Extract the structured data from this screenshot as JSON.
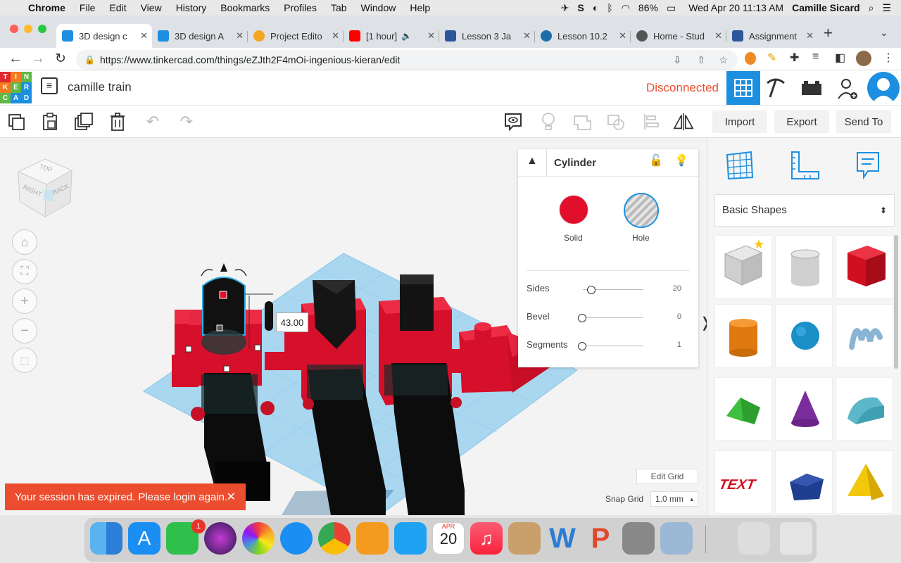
{
  "menubar": {
    "app": "Chrome",
    "items": [
      "File",
      "Edit",
      "View",
      "History",
      "Bookmarks",
      "Profiles",
      "Tab",
      "Window",
      "Help"
    ],
    "battery": "86%",
    "datetime": "Wed Apr 20  11:13 AM",
    "user": "Camille Sicard"
  },
  "tabs": [
    {
      "label": "3D design c",
      "active": true
    },
    {
      "label": "3D design A"
    },
    {
      "label": "Project Edito"
    },
    {
      "label": "[1 hour]"
    },
    {
      "label": "Lesson 3 Ja"
    },
    {
      "label": "Lesson 10.2"
    },
    {
      "label": "Home - Stud"
    },
    {
      "label": "Assignment"
    }
  ],
  "url": "https://www.tinkercad.com/things/eZJth2F4mOi-ingenious-kieran/edit",
  "logo": {
    "letters": [
      "T",
      "I",
      "N",
      "K",
      "E",
      "R",
      "C",
      "A",
      "D"
    ]
  },
  "project": {
    "name": "camille train",
    "status": "Disconnected"
  },
  "toolbar": {
    "import": "Import",
    "export": "Export",
    "send_to": "Send To"
  },
  "viewcube": {
    "top": "TOP",
    "right": "RIGHT",
    "back": "BACK"
  },
  "measure": {
    "value": "43.00"
  },
  "inspector": {
    "title": "Cylinder",
    "solid": "Solid",
    "hole": "Hole",
    "params": [
      {
        "label": "Sides",
        "value": "20",
        "fraction": 0.11
      },
      {
        "label": "Bevel",
        "value": "0",
        "fraction": 0
      },
      {
        "label": "Segments",
        "value": "1",
        "fraction": 0
      }
    ]
  },
  "grid": {
    "edit": "Edit Grid",
    "snap_label": "Snap Grid",
    "snap_value": "1.0 mm"
  },
  "sidebar": {
    "category": "Basic Shapes",
    "shapes": [
      "box-hole",
      "cylinder-hole",
      "box",
      "cylinder",
      "sphere",
      "scribble",
      "roof",
      "cone",
      "round-roof",
      "text",
      "polygon",
      "pyramid"
    ]
  },
  "toast": {
    "message": "Your session has expired. Please login again.",
    "close": "✕"
  },
  "dock": {
    "calendar_month": "APR",
    "calendar_day": "20",
    "facetime_badge": "1"
  },
  "colors": {
    "tinker_red": "#e20f2b",
    "link_blue": "#1d8fe0",
    "status": "#ec4d2e",
    "workplane": "#aad7f0"
  }
}
